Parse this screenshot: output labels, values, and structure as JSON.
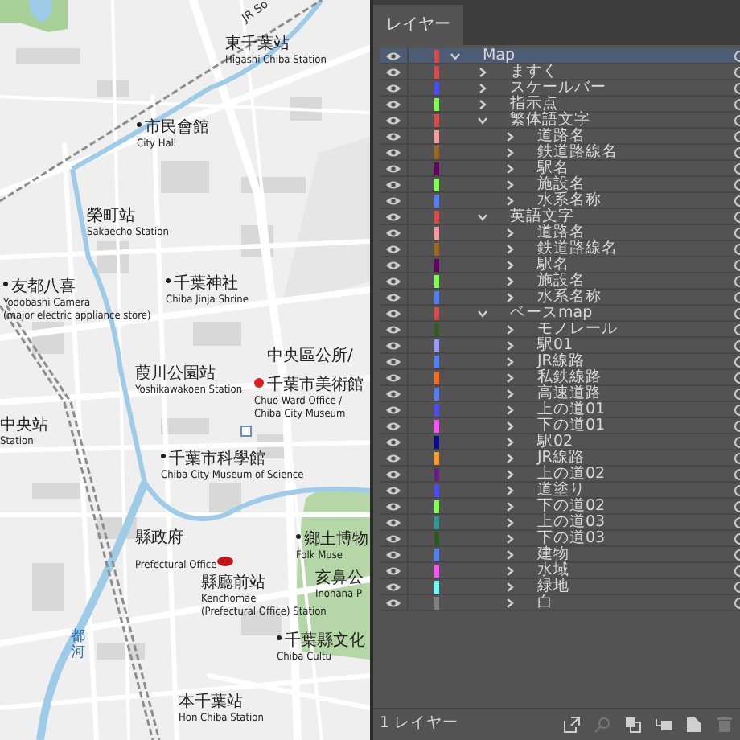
{
  "map": {
    "labels": [
      {
        "ja": "東千葉站",
        "en": [
          "Higashi Chiba Station"
        ],
        "kind": "plain"
      },
      {
        "ja": "市民會館",
        "en": [
          "City Hall"
        ],
        "kind": "dot"
      },
      {
        "ja": "榮町站",
        "en": [
          "Sakaecho Station"
        ],
        "kind": "plain"
      },
      {
        "ja": "友都八喜",
        "en": [
          "Yodobashi Camera",
          "(major electric appliance store)"
        ],
        "kind": "dot"
      },
      {
        "ja": "千葉神社",
        "en": [
          "Chiba Jinja Shrine"
        ],
        "kind": "dot"
      },
      {
        "ja": "中央區公所/",
        "kind": "plain"
      },
      {
        "ja": "千葉市美術館",
        "en": [
          "Chuo Ward Office /",
          "Chiba City Museum"
        ],
        "kind": "reddot"
      },
      {
        "ja": "葭川公園站",
        "en": [
          "Yoshikawakoen Station"
        ],
        "kind": "plain"
      },
      {
        "ja": "中央站",
        "en": [
          "Station"
        ],
        "kind": "plain"
      },
      {
        "ja": "千葉市科學館",
        "en": [
          "Chiba City Museum of Science"
        ],
        "kind": "dot"
      },
      {
        "ja": "縣政府",
        "en": [
          "Prefectural Office"
        ],
        "kind": "oval"
      },
      {
        "ja": "鄉土博物",
        "en": [
          "Folk Muse"
        ],
        "kind": "dot"
      },
      {
        "ja": "亥鼻公",
        "en": [
          "Inohana P"
        ],
        "kind": "plain"
      },
      {
        "ja": "縣廳前站",
        "en": [
          "Kenchomae",
          "(Prefectural Office) Station"
        ],
        "kind": "plain"
      },
      {
        "ja": "千葉縣文化",
        "en": [
          "Chiba Cultu"
        ],
        "kind": "dot"
      },
      {
        "ja": "本千葉站",
        "en": [
          "Hon Chiba Station"
        ],
        "kind": "plain"
      }
    ],
    "river_label": "都河",
    "rail_label": "JR So"
  },
  "panel": {
    "tab": "レイヤー",
    "layers": [
      {
        "name": "Map",
        "color": "#e04848",
        "selected": true,
        "visible": true,
        "expanded": true,
        "children": [
          {
            "name": "ますく",
            "color": "#e04848",
            "selected": false,
            "visible": true,
            "expanded": false
          },
          {
            "name": "スケールバー",
            "color": "#4a4aff",
            "selected": false,
            "visible": true,
            "expanded": false
          },
          {
            "name": "指示点",
            "color": "#7fff50",
            "selected": false,
            "visible": true,
            "expanded": false
          },
          {
            "name": "繁体語文字",
            "color": "#e04848",
            "selected": false,
            "visible": true,
            "expanded": true,
            "children": [
              {
                "name": "道路名",
                "color": "#ff9999",
                "selected": false,
                "visible": true,
                "expanded": false
              },
              {
                "name": "鉄道路線名",
                "color": "#a0661a",
                "selected": false,
                "visible": true,
                "expanded": false
              },
              {
                "name": "駅名",
                "color": "#660066",
                "selected": false,
                "visible": true,
                "expanded": false
              },
              {
                "name": "施設名",
                "color": "#7fff50",
                "selected": false,
                "visible": true,
                "expanded": false
              },
              {
                "name": "水系名称",
                "color": "#4f7fff",
                "selected": false,
                "visible": true,
                "expanded": false
              }
            ]
          },
          {
            "name": "英語文字",
            "color": "#e04848",
            "selected": false,
            "visible": true,
            "expanded": true,
            "children": [
              {
                "name": "道路名",
                "color": "#ff9999",
                "selected": false,
                "visible": true,
                "expanded": false
              },
              {
                "name": "鉄道路線名",
                "color": "#a0661a",
                "selected": false,
                "visible": true,
                "expanded": false
              },
              {
                "name": "駅名",
                "color": "#660066",
                "selected": false,
                "visible": true,
                "expanded": false
              },
              {
                "name": "施設名",
                "color": "#7fff50",
                "selected": false,
                "visible": true,
                "expanded": false
              },
              {
                "name": "水系名称",
                "color": "#4f7fff",
                "selected": false,
                "visible": true,
                "expanded": false
              }
            ]
          },
          {
            "name": "ベースmap",
            "color": "#e04848",
            "selected": false,
            "visible": true,
            "expanded": true,
            "children": [
              {
                "name": "モノレール",
                "color": "#2e5e1e",
                "selected": false,
                "visible": true,
                "expanded": false
              },
              {
                "name": "駅01",
                "color": "#9999ff",
                "selected": false,
                "visible": true,
                "expanded": false
              },
              {
                "name": "JR線路",
                "color": "#4f7fff",
                "selected": false,
                "visible": true,
                "expanded": false
              },
              {
                "name": "私鉄線路",
                "color": "#ff6a1a",
                "selected": false,
                "visible": true,
                "expanded": false
              },
              {
                "name": "高速道路",
                "color": "#4f7fff",
                "selected": false,
                "visible": true,
                "expanded": false
              },
              {
                "name": "上の道01",
                "color": "#4a4aff",
                "selected": false,
                "visible": true,
                "expanded": false
              },
              {
                "name": "下の道01",
                "color": "#ff4fff",
                "selected": false,
                "visible": true,
                "expanded": false
              },
              {
                "name": "駅02",
                "color": "#0a0a99",
                "selected": false,
                "visible": true,
                "expanded": false
              },
              {
                "name": "JR線路",
                "color": "#ff9922",
                "selected": false,
                "visible": true,
                "expanded": false
              },
              {
                "name": "上の道02",
                "color": "#6a1a80",
                "selected": false,
                "visible": true,
                "expanded": false
              },
              {
                "name": "道塗り",
                "color": "#4a4aff",
                "selected": false,
                "visible": true,
                "expanded": false
              },
              {
                "name": "下の道02",
                "color": "#7fff50",
                "selected": false,
                "visible": true,
                "expanded": false
              },
              {
                "name": "上の道03",
                "color": "#2a9a9a",
                "selected": false,
                "visible": true,
                "expanded": false
              },
              {
                "name": "下の道03",
                "color": "#2a5a1a",
                "selected": false,
                "visible": true,
                "expanded": false
              },
              {
                "name": "建物",
                "color": "#4f7fff",
                "selected": false,
                "visible": true,
                "expanded": false
              },
              {
                "name": "水域",
                "color": "#ff4fff",
                "selected": false,
                "visible": true,
                "expanded": false
              },
              {
                "name": "緑地",
                "color": "#66ffff",
                "selected": false,
                "visible": true,
                "expanded": false
              },
              {
                "name": "白",
                "color": "#808080",
                "selected": false,
                "visible": true,
                "expanded": false
              }
            ]
          }
        ]
      }
    ],
    "footer": "1 レイヤー"
  }
}
